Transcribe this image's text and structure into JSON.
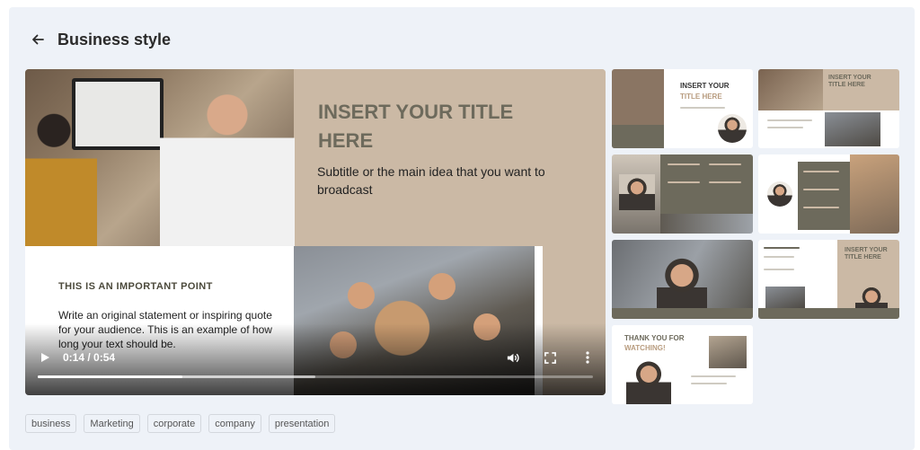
{
  "header": {
    "title": "Business style",
    "back_icon": "arrow-left-icon"
  },
  "video": {
    "slide": {
      "title": "INSERT YOUR TITLE HERE",
      "subtitle": "Subtitle or the main idea that you want to broadcast",
      "point_heading": "THIS IS AN IMPORTANT POINT",
      "quote": "Write an original statement or inspiring quote for your audience. This is an example of how long your text should be."
    },
    "time": "0:14 / 0:54",
    "progress_fraction": 0.26,
    "buffered_fraction": 0.5,
    "icons": [
      "play-icon",
      "volume-icon",
      "fullscreen-icon",
      "more-vertical-icon"
    ]
  },
  "thumbnails": [
    {
      "title_line1": "INSERT YOUR",
      "title_line2": "TITLE HERE"
    },
    {
      "title_line1": "INSERT YOUR",
      "title_line2": "TITLE HERE"
    },
    {
      "title_line1": "",
      "title_line2": ""
    },
    {
      "title_line1": "",
      "title_line2": ""
    },
    {
      "title_line1": "",
      "title_line2": ""
    },
    {
      "title_line1": "INSERT YOUR",
      "title_line2": "TITLE HERE"
    },
    {
      "title_line1": "THANK YOU FOR",
      "title_line2": "WATCHING!"
    }
  ],
  "tags": [
    "business",
    "Marketing",
    "corporate",
    "company",
    "presentation"
  ],
  "colors": {
    "accent_beige": "#cbb9a5",
    "accent_olive": "#6d6a5c",
    "background": "#eef2f8"
  }
}
